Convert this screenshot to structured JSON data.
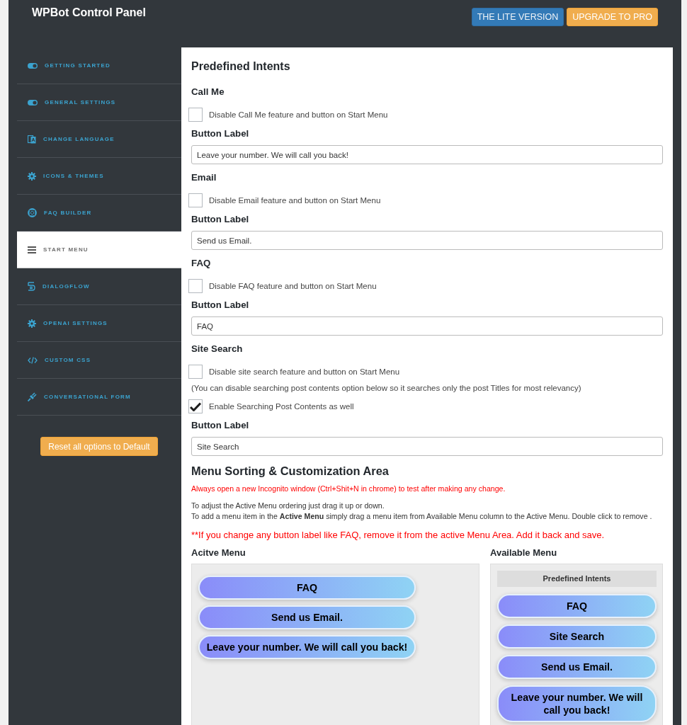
{
  "header": {
    "title": "WPBot Control Panel",
    "buttons": [
      {
        "label": "THE LITE VERSION",
        "kind": "info"
      },
      {
        "label": "UPGRADE TO PRO",
        "kind": "warning"
      }
    ]
  },
  "sidebar": {
    "items": [
      {
        "label": "GETTING STARTED",
        "selected": false
      },
      {
        "label": "GENERAL SETTINGS",
        "selected": false
      },
      {
        "label": "CHANGE LANGUAGE",
        "selected": false
      },
      {
        "label": "ICONS & THEMES",
        "selected": false
      },
      {
        "label": "FAQ BUILDER",
        "selected": false
      },
      {
        "label": "START MENU",
        "selected": true
      },
      {
        "label": "DIALOGFLOW",
        "selected": false
      },
      {
        "label": "OPENAI SETTINGS",
        "selected": false
      },
      {
        "label": "CUSTOM CSS",
        "selected": false
      },
      {
        "label": "CONVERSATIONAL FORM",
        "selected": false
      }
    ],
    "reset_button": "Reset all options to Default"
  },
  "predefined_intents": {
    "title": "Predefined Intents",
    "intents": [
      {
        "heading": "Call Me",
        "rows": [
          {
            "kind": "checkbox",
            "label": "Disable Call Me feature and button on Start Menu",
            "checked": false
          }
        ],
        "field_label": "Button Label",
        "value": "Leave your number. We will call you back!"
      },
      {
        "heading": "Email",
        "rows": [
          {
            "kind": "checkbox",
            "label": "Disable Email feature and button on Start Menu",
            "checked": false
          }
        ],
        "field_label": "Button Label",
        "value": "Send us Email."
      },
      {
        "heading": "FAQ",
        "rows": [
          {
            "kind": "checkbox",
            "label": "Disable FAQ feature and button on Start Menu",
            "checked": false
          }
        ],
        "field_label": "Button Label",
        "value": "FAQ"
      },
      {
        "heading": "Site Search",
        "rows": [
          {
            "kind": "checkbox",
            "label": "Disable site search feature and button on Start Menu",
            "checked": false
          },
          {
            "kind": "note",
            "label": "(You can disable searching post contents option below so it searches only the post Titles for most relevancy)"
          },
          {
            "kind": "checkbox",
            "label": "Enable Searching Post Contents as well",
            "checked": true
          }
        ],
        "field_label": "Button Label",
        "value": "Site Search"
      }
    ]
  },
  "menu_sorting": {
    "title": "Menu Sorting & Customization Area",
    "warning": "Always open a new Incognito window (Ctrl+Shit+N in chrome) to test after making any change.",
    "instructions": [
      "To adjust the Active Menu ordering just drag it up or down.",
      "To add a menu item in the **Active Menu** simply drag a menu item from Available Menu column to the Active Menu. Double click to remove ."
    ],
    "alert": "**If you change any button label like FAQ, remove it from the active Menu Area. Add it back and save.",
    "active_menu": {
      "title": "Acitve Menu",
      "items": [
        "FAQ",
        "Send us Email.",
        "Leave your number. We will call you back!"
      ]
    },
    "available_menu": {
      "title": "Available Menu",
      "group_title": "Predefined Intents",
      "items": [
        "FAQ",
        "Site Search",
        "Send us Email.",
        "Leave your number. We will call you back!"
      ]
    }
  }
}
